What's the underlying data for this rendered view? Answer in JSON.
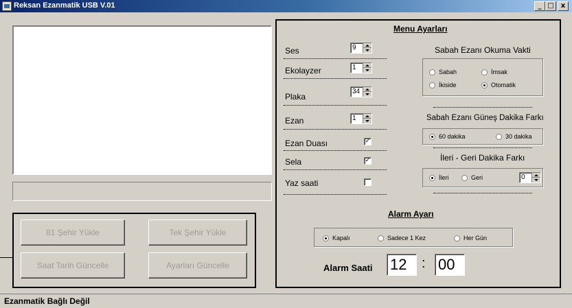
{
  "window": {
    "title": "Reksan Ezanmatik USB V.01",
    "minimize": "_",
    "maximize": "□",
    "close": "x"
  },
  "left": {
    "buttons": {
      "load_81": "81 Şehir Yükle",
      "load_single": "Tek Şehir Yükle",
      "update_datetime": "Saat Tarih Güncelle",
      "update_settings": "Ayarları Güncelle"
    }
  },
  "menu": {
    "title": "Menu Ayarları",
    "ses": {
      "label": "Ses",
      "value": "9"
    },
    "ekolayzer": {
      "label": "Ekolayzer",
      "value": "1"
    },
    "plaka": {
      "label": "Plaka",
      "value": "34"
    },
    "ezan": {
      "label": "Ezan",
      "value": "1"
    },
    "ezan_duasi": {
      "label": "Ezan Duası",
      "checked": true
    },
    "sela": {
      "label": "Sela",
      "checked": true
    },
    "yaz_saati": {
      "label": "Yaz saati",
      "checked": false
    },
    "sabah_title": "Sabah Ezanı Okuma Vakti",
    "sabah_opts": [
      "Sabah",
      "İmsak",
      "İkiside",
      "Otomatik"
    ],
    "sabah_selected": "Otomatik",
    "gunes_title": "Sabah Ezanı Güneş Dakika Farkı",
    "gunes_opts": [
      "60 dakika",
      "30 dakika"
    ],
    "gunes_selected": "60 dakika",
    "ileri_title": "İleri - Geri Dakika Farkı",
    "ileri_opts": [
      "İleri",
      "Geri"
    ],
    "ileri_selected": "İleri",
    "ileri_value": "0",
    "check_mark": "✓"
  },
  "alarm": {
    "title": "Alarm Ayarı",
    "opts": [
      "Kapalı",
      "Sadece 1 Kez",
      "Her Gün"
    ],
    "selected": "Kapalı",
    "time_label": "Alarm Saati",
    "hour": "12",
    "sep": ":",
    "minute": "00"
  },
  "status": "Ezanmatik Bağlı Değil"
}
